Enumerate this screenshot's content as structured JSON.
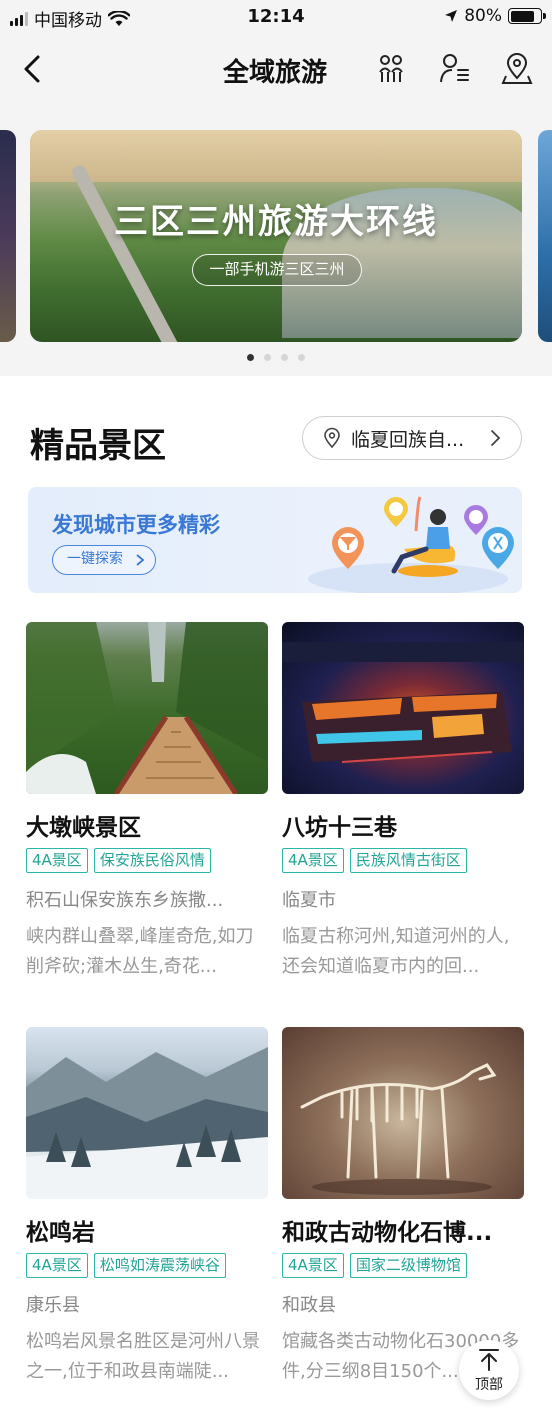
{
  "status_bar": {
    "carrier": "中国移动",
    "time": "12:14",
    "battery": "80%",
    "battery_level": 0.8
  },
  "nav": {
    "title": "全域旅游",
    "icons": [
      "back-icon",
      "couple-icon",
      "guide-icon",
      "location-pin-icon"
    ]
  },
  "banner": {
    "title": "三区三州旅游大环线",
    "subtitle": "一部手机游三区三州",
    "slides": 4,
    "active_slide": 1
  },
  "section": {
    "title": "精品景区",
    "city": "临夏回族自..."
  },
  "discover": {
    "title": "发现城市更多精彩",
    "button": "一键探索"
  },
  "cards": [
    {
      "name": "大墩峡景区",
      "tags": [
        "4A景区",
        "保安族民俗风情"
      ],
      "location": "积石山保安族东乡族撒...",
      "desc": "峡内群山叠翠,峰崖奇危,如刀削斧砍;灌木丛生,奇花..."
    },
    {
      "name": "八坊十三巷",
      "tags": [
        "4A景区",
        "民族风情古街区"
      ],
      "location": "临夏市",
      "desc": "临夏古称河州,知道河州的人,还会知道临夏市内的回..."
    },
    {
      "name": "松鸣岩",
      "tags": [
        "4A景区",
        "松鸣如涛震荡峡谷"
      ],
      "location": "康乐县",
      "desc": "松鸣岩风景名胜区是河州八景之一,位于和政县南端陡..."
    },
    {
      "name": "和政古动物化石博...",
      "tags": [
        "4A景区",
        "国家二级博物馆"
      ],
      "location": "和政县",
      "desc": "馆藏各类古动物化石30000多件,分三纲8目150个..."
    }
  ],
  "back_to_top": "顶部"
}
